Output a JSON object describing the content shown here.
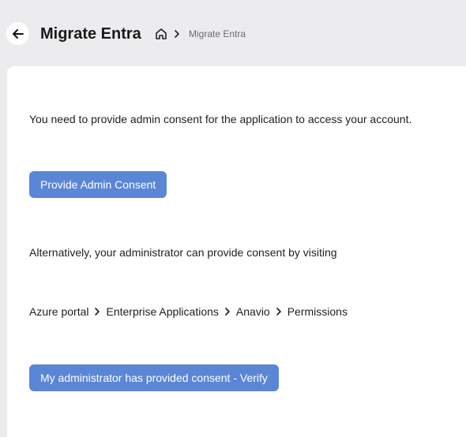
{
  "header": {
    "title": "Migrate Entra",
    "breadcrumb": {
      "current": "Migrate Entra"
    }
  },
  "content": {
    "consent_message": "You need to provide admin consent for the application to access your account.",
    "provide_consent_label": "Provide Admin Consent",
    "alternative_message": "Alternatively, your administrator can provide consent by visiting",
    "path": [
      "Azure portal",
      "Enterprise Applications",
      "Anavio",
      "Permissions"
    ],
    "verify_label": "My administrator has provided consent - Verify"
  },
  "colors": {
    "background": "#ececee",
    "card": "#ffffff",
    "primary_button": "#5b86d6"
  },
  "icons": {
    "back": "arrow-left-icon",
    "home": "home-icon",
    "separator": "chevron-right-icon"
  }
}
